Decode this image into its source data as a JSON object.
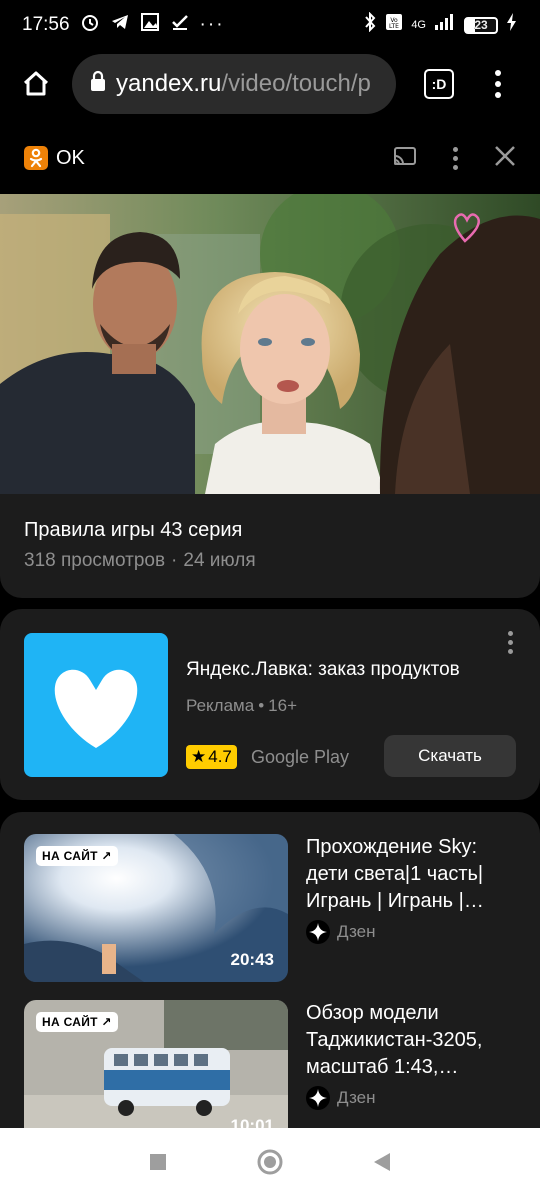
{
  "status_bar": {
    "time": "17:56",
    "network": "4G",
    "battery": "23"
  },
  "browser": {
    "url_domain": "yandex.ru",
    "url_path": "/video/touch/p",
    "tabs_label": ":D"
  },
  "site_header": {
    "site_name": "OK"
  },
  "video": {
    "title": "Правила игры 43 серия",
    "views": "318 просмотров",
    "separator": "·",
    "date": "24 июля"
  },
  "ad": {
    "title": "Яндекс.Лавка: заказ продуктов",
    "label": "Реклама",
    "separator": "•",
    "age": "16+",
    "rating": "4.7",
    "store": "Google Play",
    "download_label": "Скачать"
  },
  "related": [
    {
      "badge": "НА САЙТ",
      "duration": "20:43",
      "title": "Прохождение Sky: дети света|1 часть| Игрань | Игрань |…",
      "source": "Дзен"
    },
    {
      "badge": "НА САЙТ",
      "duration": "10:01",
      "title": "Обзор модели Таджикистан-3205, масштаб 1:43,…",
      "source": "Дзен"
    }
  ],
  "colors": {
    "ok_brand": "#ee8208",
    "ad_brand": "#1fb4f5",
    "rating_bg": "#ffcc00"
  }
}
